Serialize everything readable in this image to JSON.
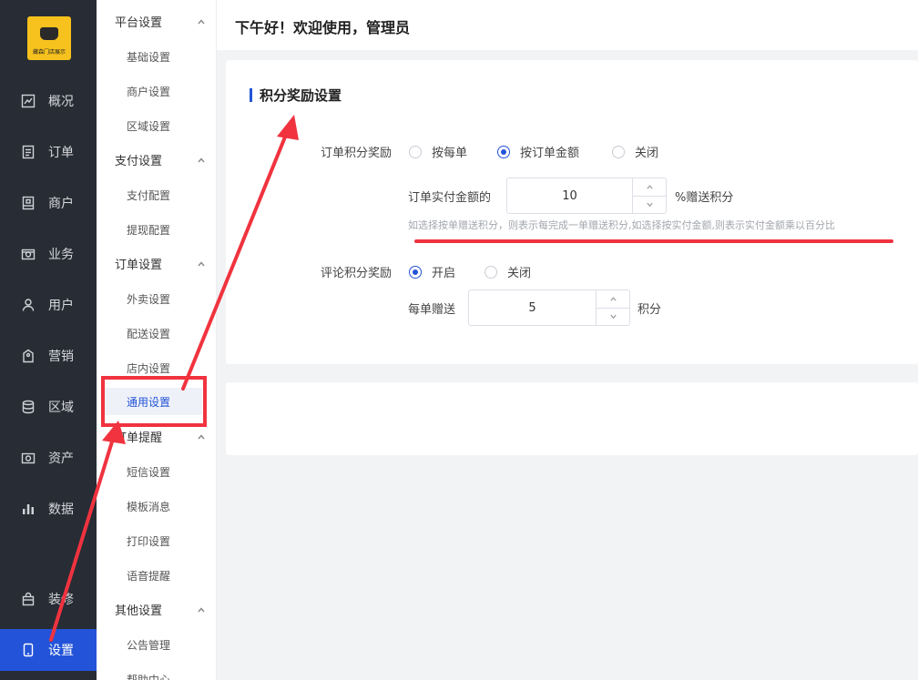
{
  "logo": {
    "caption": "藏森门店展示"
  },
  "nav": {
    "items": [
      {
        "label": "概况",
        "icon": "trend-chart-icon"
      },
      {
        "label": "订单",
        "icon": "order-list-icon"
      },
      {
        "label": "商户",
        "icon": "merchant-icon"
      },
      {
        "label": "业务",
        "icon": "business-icon"
      },
      {
        "label": "用户",
        "icon": "user-icon"
      },
      {
        "label": "营销",
        "icon": "marketing-icon"
      },
      {
        "label": "区域",
        "icon": "database-icon"
      },
      {
        "label": "资产",
        "icon": "asset-icon"
      },
      {
        "label": "数据",
        "icon": "bar-chart-icon"
      },
      {
        "label": "装修",
        "icon": "bag-icon"
      },
      {
        "label": "设置",
        "icon": "phone-icon"
      }
    ],
    "active": "设置"
  },
  "submenu": {
    "groups": [
      {
        "title": "平台设置",
        "items": [
          "基础设置",
          "商户设置",
          "区域设置"
        ]
      },
      {
        "title": "支付设置",
        "items": [
          "支付配置",
          "提现配置"
        ]
      },
      {
        "title": "订单设置",
        "items": [
          "外卖设置",
          "配送设置",
          "店内设置",
          "通用设置"
        ]
      },
      {
        "title": "订单提醒",
        "items": [
          "短信设置",
          "模板消息",
          "打印设置",
          "语音提醒"
        ]
      },
      {
        "title": "其他设置",
        "items": [
          "公告管理",
          "帮助中心"
        ]
      }
    ],
    "active_item": "通用设置"
  },
  "header": {
    "greeting": "下午好！欢迎使用，管理员"
  },
  "card": {
    "title": "积分奖励设置",
    "order_reward": {
      "label": "订单积分奖励",
      "options": [
        "按每单",
        "按订单金额",
        "关闭"
      ],
      "selected": "按订单金额",
      "amount_label": "订单实付金额的",
      "amount_value": "10",
      "amount_suffix": "%赠送积分",
      "hint": "如选择按单赠送积分，则表示每完成一单赠送积分,如选择按实付金额,则表示实付金额乘以百分比"
    },
    "review_reward": {
      "label": "评论积分奖励",
      "options": [
        "开启",
        "关闭"
      ],
      "selected": "开启",
      "per_label": "每单赠送",
      "per_value": "5",
      "per_suffix": "积分"
    }
  },
  "colors": {
    "accent": "#2353d8",
    "sidebar": "#282c34",
    "annotation": "#f0333f",
    "logo": "#f7c21d"
  }
}
